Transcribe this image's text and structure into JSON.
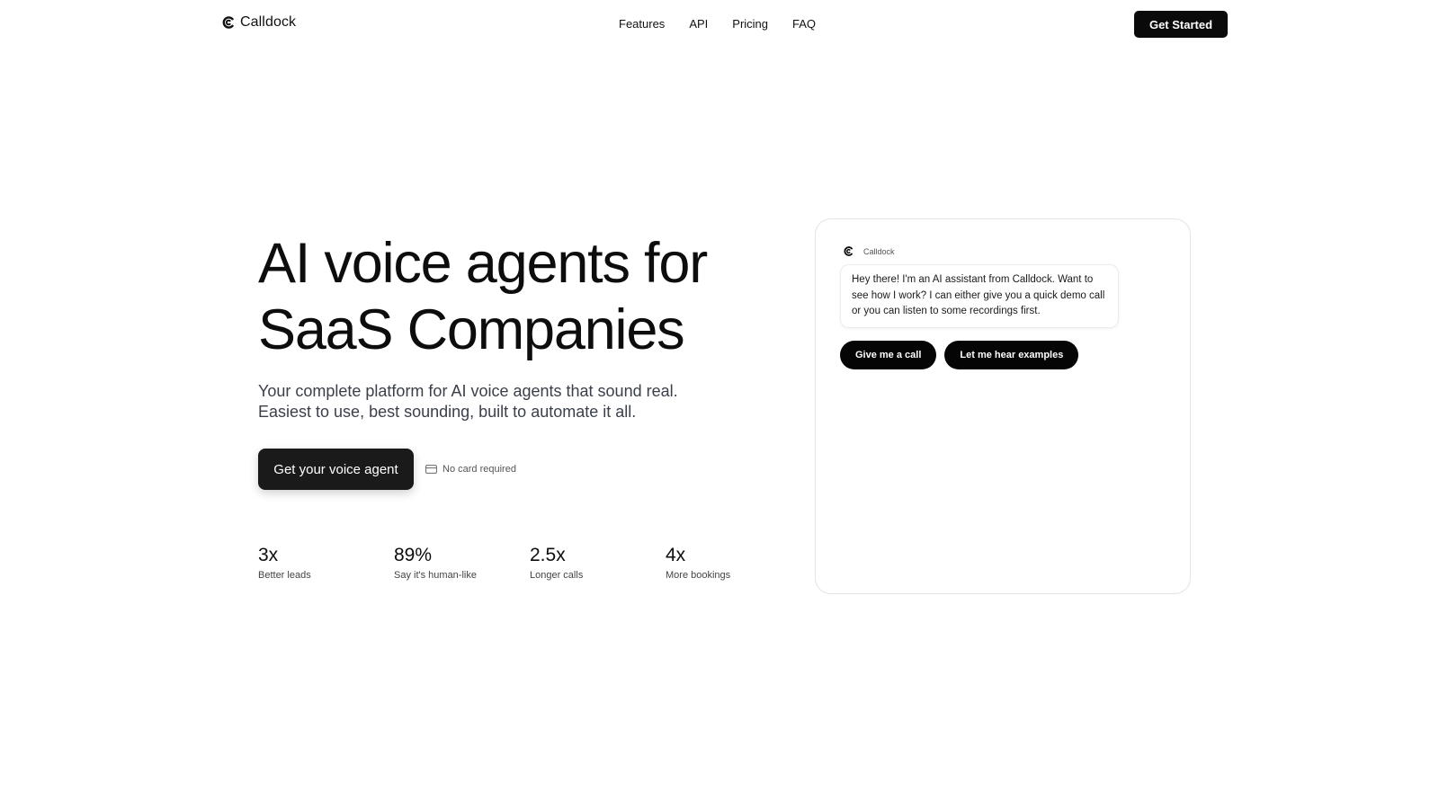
{
  "header": {
    "brand": "Calldock",
    "nav": [
      {
        "label": "Features"
      },
      {
        "label": "API"
      },
      {
        "label": "Pricing"
      },
      {
        "label": "FAQ"
      }
    ],
    "cta_label": "Get Started"
  },
  "hero": {
    "title_line1": "AI voice agents for",
    "title_line2": "SaaS Companies",
    "subtitle_line1": "Your complete platform for AI voice agents that sound real.",
    "subtitle_line2": "Easiest to use, best sounding, built to automate it all.",
    "cta_label": "Get your voice agent",
    "note": "No card required",
    "note_icon": "credit-card-icon"
  },
  "stats": [
    {
      "value": "3x",
      "label": "Better leads"
    },
    {
      "value": "89%",
      "label": "Say it's human-like"
    },
    {
      "value": "2.5x",
      "label": "Longer calls"
    },
    {
      "value": "4x",
      "label": "More bookings"
    }
  ],
  "chat": {
    "sender": "Calldock",
    "message": "Hey there! I'm an AI assistant from Calldock. Want to see how I work? I can either give you a quick demo call or you can listen to some recordings first.",
    "actions": [
      {
        "label": "Give me a call"
      },
      {
        "label": "Let me hear examples"
      }
    ]
  },
  "colors": {
    "primary": "#0a0a0a",
    "text": "#111111",
    "muted": "#3a3f4a",
    "border": "#e4e4e7",
    "background": "#ffffff"
  }
}
